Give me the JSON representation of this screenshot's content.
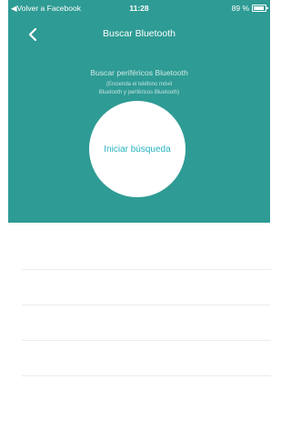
{
  "status_bar": {
    "back_app": "Volver a Facebook",
    "time": "11:28",
    "battery": "89 %"
  },
  "nav": {
    "back_icon": "chevron-left-icon",
    "title": "Buscar Bluetooth"
  },
  "search": {
    "heading": "Buscar periféricos Bluetooth",
    "note_line1": "(Encienda el teléfono móvil",
    "note_line2": "Bluetooth y periféricos Bluetooth)",
    "button_label": "Iniciar búsqueda"
  },
  "colors": {
    "header_bg": "#2e9b94",
    "button_text": "#29b3c1",
    "divider": "#ececec"
  }
}
